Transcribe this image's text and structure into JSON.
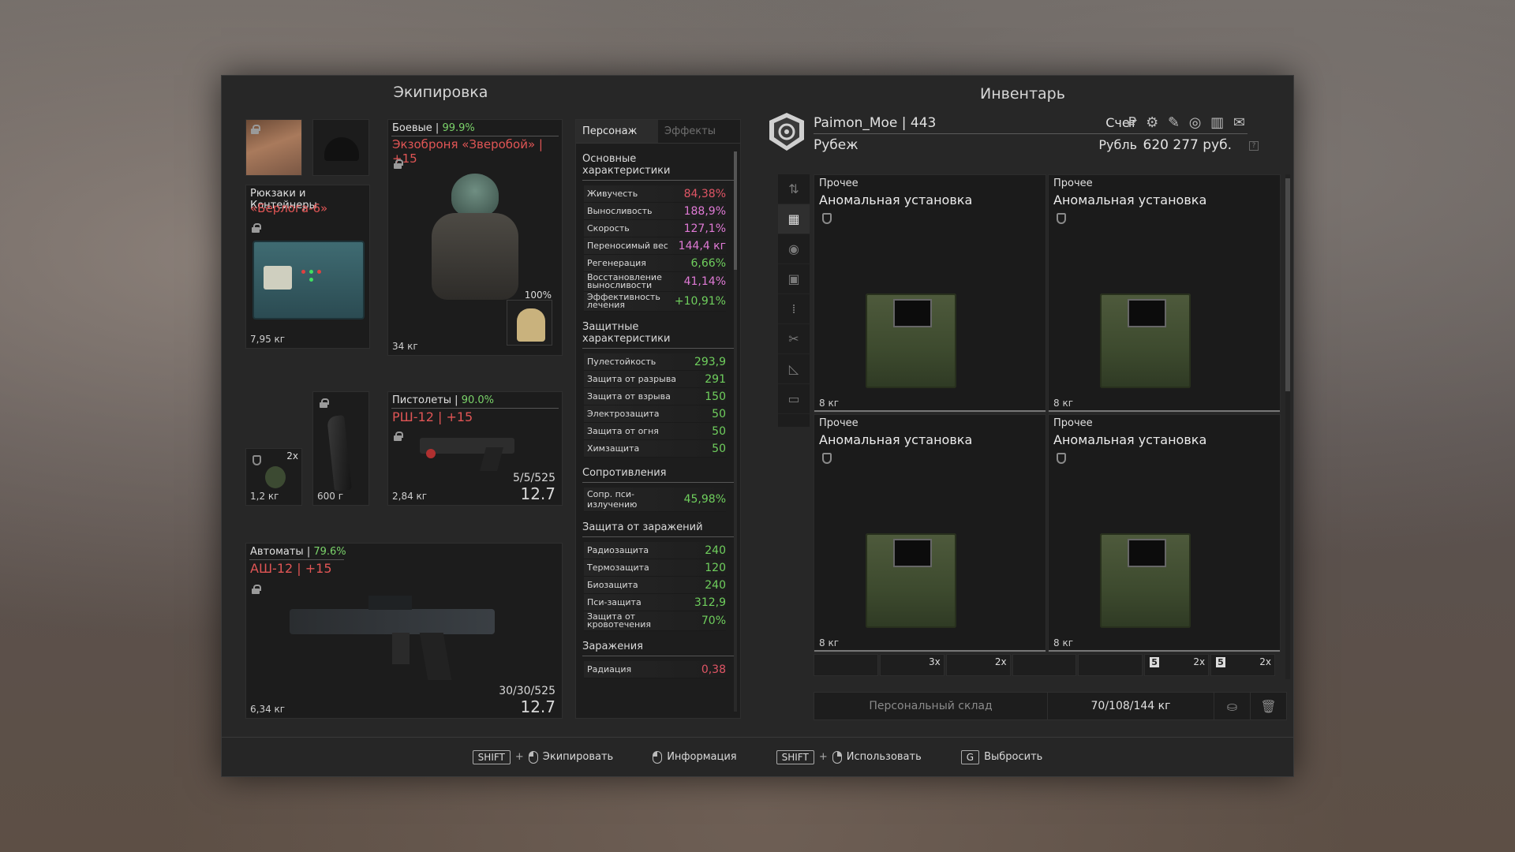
{
  "equipment": {
    "title": "Экипировка",
    "backpack": {
      "category": "Рюкзаки и Контейнеры",
      "name": "«Берлога-6»",
      "weight": "7,95 кг"
    },
    "armor": {
      "category": "Боевые",
      "condition": "99.9%",
      "name": "Экзоброня «Зверобой» | +15",
      "weight": "34 кг",
      "plate_percent": "100%"
    },
    "grenade": {
      "count": "2x",
      "weight": "1,2 кг"
    },
    "knife": {
      "weight": "600 г"
    },
    "pistol": {
      "category": "Пистолеты",
      "condition": "90.0%",
      "name": "РШ-12 | +15",
      "weight": "2,84 кг",
      "ammo": "5/5/525",
      "caliber": "12.7"
    },
    "rifle": {
      "category": "Автоматы",
      "condition": "79.6%",
      "name": "АШ-12 | +15",
      "weight": "6,34 кг",
      "ammo": "30/30/525",
      "caliber": "12.7"
    }
  },
  "stats": {
    "tabs": [
      "Персонаж",
      "Эффекты"
    ],
    "main_title": "Основные характеристики",
    "main": [
      {
        "label": "Живучесть",
        "value": "84,38%",
        "color": "red"
      },
      {
        "label": "Выносливость",
        "value": "188,9%",
        "color": "pink"
      },
      {
        "label": "Скорость",
        "value": "127,1%",
        "color": "pink"
      },
      {
        "label": "Переносимый вес",
        "value": "144,4 кг",
        "color": "pink"
      },
      {
        "label": "Регенерация",
        "value": "6,66%",
        "color": "green"
      },
      {
        "label": "Восстановление выносливости",
        "value": "41,14%",
        "color": "pink"
      },
      {
        "label": "Эффективность лечения",
        "value": "+10,91%",
        "color": "green"
      }
    ],
    "protect_title": "Защитные характеристики",
    "protect": [
      {
        "label": "Пулестойкость",
        "value": "293,9",
        "color": "green"
      },
      {
        "label": "Защита от разрыва",
        "value": "291",
        "color": "green"
      },
      {
        "label": "Защита от взрыва",
        "value": "150",
        "color": "green"
      },
      {
        "label": "Электрозащита",
        "value": "50",
        "color": "green"
      },
      {
        "label": "Защита от огня",
        "value": "50",
        "color": "green"
      },
      {
        "label": "Химзащита",
        "value": "50",
        "color": "green"
      }
    ],
    "resist_title": "Сопротивления",
    "resist": [
      {
        "label": "Сопр. пси-излучению",
        "value": "45,98%",
        "color": "green"
      }
    ],
    "contam_title": "Защита от заражений",
    "contam": [
      {
        "label": "Радиозащита",
        "value": "240",
        "color": "green"
      },
      {
        "label": "Термозащита",
        "value": "120",
        "color": "green"
      },
      {
        "label": "Биозащита",
        "value": "240",
        "color": "green"
      },
      {
        "label": "Пси-защита",
        "value": "312,9",
        "color": "green"
      },
      {
        "label": "Защита от кровотечения",
        "value": "70%",
        "color": "green"
      }
    ],
    "infect_title": "Заражения",
    "infect": [
      {
        "label": "Радиация",
        "value": "0,38",
        "color": "red"
      }
    ]
  },
  "inventory": {
    "title": "Инвентарь",
    "player": "Paimon_Moe | 443",
    "faction": "Рубеж",
    "account_label": "Счет",
    "currency_label": "Рубль",
    "money": "620 277 руб.",
    "currency_icons": "₽ ⚙ ✎ ◎ ▥ ✉",
    "items": [
      {
        "category": "Прочее",
        "name": "Аномальная установка",
        "weight": "8 кг"
      },
      {
        "category": "Прочее",
        "name": "Аномальная установка",
        "weight": "8 кг"
      },
      {
        "category": "Прочее",
        "name": "Аномальная установка",
        "weight": "8 кг"
      },
      {
        "category": "Прочее",
        "name": "Аномальная установка",
        "weight": "8 кг"
      }
    ],
    "mini_counts": [
      "",
      "3x",
      "2x",
      "",
      "",
      "2x",
      "2x"
    ],
    "mini_nums": [
      "",
      "",
      "",
      "",
      "",
      "5",
      "5"
    ],
    "stash_label": "Персональный склад",
    "load": "70/108/144 кг"
  },
  "hints": [
    {
      "key": "SHIFT",
      "label": "Экипировать"
    },
    {
      "label": "Информация"
    },
    {
      "key": "SHIFT",
      "label": "Использовать"
    },
    {
      "key": "G",
      "label": "Выбросить"
    }
  ]
}
